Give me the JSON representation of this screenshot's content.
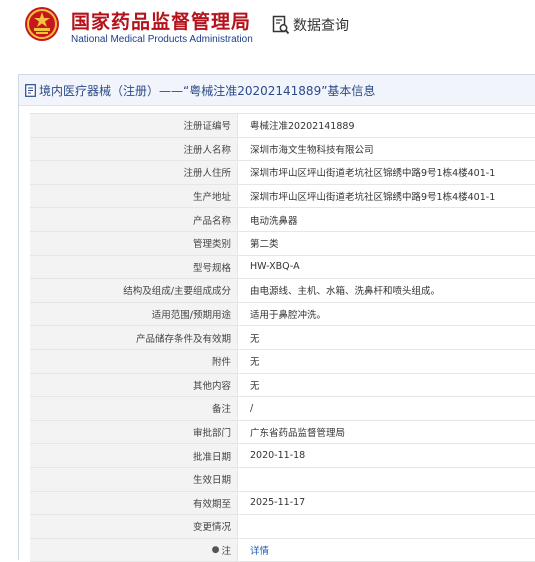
{
  "header": {
    "title_cn": "国家药品监督管理局",
    "title_en": "National Medical Products Administration",
    "search_label": "数据查询"
  },
  "panel": {
    "title": "境内医疗器械（注册）——“粤械注准20202141889”基本信息"
  },
  "rows": [
    {
      "label": "注册证编号",
      "value": "粤械注准20202141889"
    },
    {
      "label": "注册人名称",
      "value": "深圳市海文生物科技有限公司"
    },
    {
      "label": "注册人住所",
      "value": "深圳市坪山区坪山街道老坑社区锦绣中路9号1栋4楼401-1"
    },
    {
      "label": "生产地址",
      "value": "深圳市坪山区坪山街道老坑社区锦绣中路9号1栋4楼401-1"
    },
    {
      "label": "产品名称",
      "value": "电动洗鼻器"
    },
    {
      "label": "管理类别",
      "value": "第二类"
    },
    {
      "label": "型号规格",
      "value": "HW-XBQ-A"
    },
    {
      "label": "结构及组成/主要组成成分",
      "value": "由电源线、主机、水箱、洗鼻杆和喷头组成。"
    },
    {
      "label": "适用范围/预期用途",
      "value": "适用于鼻腔冲洗。"
    },
    {
      "label": "产品储存条件及有效期",
      "value": "无"
    },
    {
      "label": "附件",
      "value": "无"
    },
    {
      "label": "其他内容",
      "value": "无"
    },
    {
      "label": "备注",
      "value": "/"
    },
    {
      "label": "审批部门",
      "value": "广东省药品监督管理局"
    },
    {
      "label": "批准日期",
      "value": "2020-11-18"
    },
    {
      "label": "生效日期",
      "value": ""
    },
    {
      "label": "有效期至",
      "value": "2025-11-17"
    },
    {
      "label": "变更情况",
      "value": ""
    },
    {
      "label": "注",
      "value": "详情"
    }
  ],
  "colors": {
    "brand_red": "#b5121b",
    "brand_blue": "#1d3e8a",
    "link_blue": "#1d5bb8"
  },
  "icons": [
    "national-emblem-icon",
    "search-doc-icon",
    "doc-icon",
    "lightbulb-icon"
  ]
}
